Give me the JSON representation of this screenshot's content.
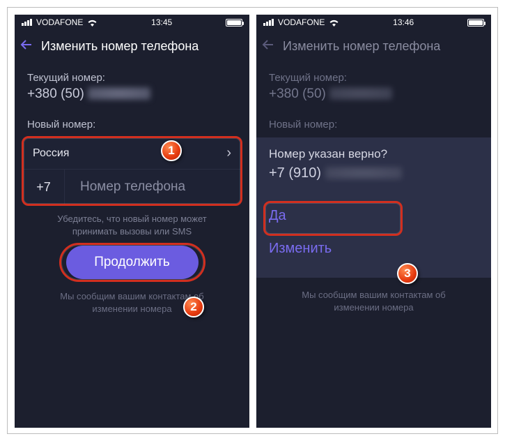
{
  "left": {
    "status": {
      "carrier": "VODAFONE",
      "time": "13:45"
    },
    "title": "Изменить номер телефона",
    "current_label": "Текущий номер:",
    "current_number": "+380 (50)",
    "new_label": "Новый номер:",
    "country": "Россия",
    "prefix": "+7",
    "phone_placeholder": "Номер телефона",
    "help": "Убедитесь, что новый номер может принимать вызовы или SMS",
    "continue": "Продолжить",
    "footer": "Мы сообщим вашим контактам об изменении номера"
  },
  "right": {
    "status": {
      "carrier": "VODAFONE",
      "time": "13:46"
    },
    "title": "Изменить номер телефона",
    "current_label": "Текущий номер:",
    "current_number": "+380 (50)",
    "new_label": "Новый номер:",
    "confirm_q": "Номер указан верно?",
    "confirm_number": "+7 (910)",
    "yes": "Да",
    "change": "Изменить",
    "footer": "Мы сообщим вашим контактам об изменении номера"
  },
  "badges": {
    "b1": "1",
    "b2": "2",
    "b3": "3"
  }
}
